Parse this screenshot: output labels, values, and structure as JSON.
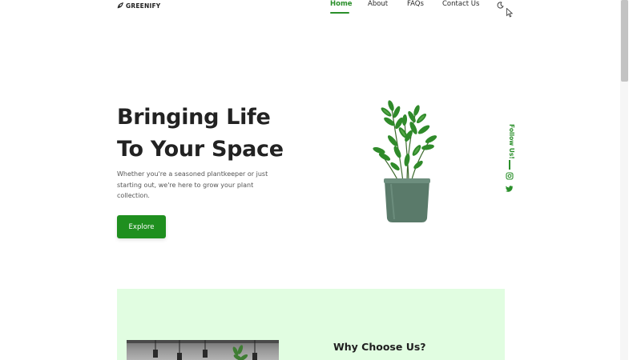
{
  "brand": {
    "name": "GREENIFY",
    "logo_icon": "leaf-icon"
  },
  "nav": {
    "items": [
      {
        "label": "Home",
        "active": true
      },
      {
        "label": "About",
        "active": false
      },
      {
        "label": "FAQs",
        "active": false
      },
      {
        "label": "Contact Us",
        "active": false
      }
    ],
    "theme_toggle_icon": "moon-icon"
  },
  "hero": {
    "title_line1": "Bringing Life",
    "title_line2": "To Your Space",
    "subtitle": "Whether you're a seasoned plantkeeper or just starting out, we're here to grow your plant collection.",
    "cta_label": "Explore",
    "image": "potted-plant-image"
  },
  "social": {
    "label": "Follow Us!",
    "icons": [
      "instagram-icon",
      "twitter-icon"
    ]
  },
  "why": {
    "title": "Why Choose Us?"
  },
  "colors": {
    "accent": "#1f8f1f",
    "accent_text": "#2a8f2a",
    "section_bg": "#e1fde1",
    "text": "#222222"
  }
}
